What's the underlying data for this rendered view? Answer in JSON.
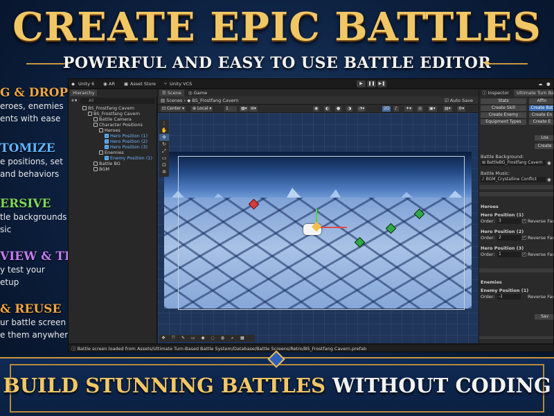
{
  "banner": {
    "title": "CREATE EPIC BATTLES",
    "subtitle": "POWERFUL AND EASY TO USE BATTLE EDITOR",
    "bottom_gold_1": "BUILD STUNNING ",
    "bottom_gold_2": "BATTLES",
    "bottom_white": " WITHOUT CODING"
  },
  "features": [
    {
      "heading": "G & DROP",
      "color": "#f1a640",
      "lines": [
        "eroes, enemies",
        "ents with ease"
      ]
    },
    {
      "heading": "TOMIZE",
      "color": "#5fb6ff",
      "lines": [
        "e positions, set",
        " and behaviors"
      ]
    },
    {
      "heading": "ERSIVE",
      "color": "#7ed957",
      "lines": [
        "tle backgrounds",
        "sic"
      ]
    },
    {
      "heading": "VIEW & TEST",
      "color": "#c47df0",
      "lines": [
        "y test your",
        "etup"
      ]
    },
    {
      "heading": "& REUSE",
      "color": "#f1a640",
      "lines": [
        "ur battle screen",
        "e them anywhere"
      ]
    }
  ],
  "toolbar": {
    "unity": "Unity 6",
    "ar": "AR",
    "asset_store": "Asset Store",
    "vcs": "Unity VCS",
    "play": "▶",
    "pause": "❚❚",
    "step": "▶❚"
  },
  "hierarchy": {
    "tab": "Hierarchy",
    "search_placeholder": "All",
    "items": [
      {
        "label": "BS_Frostfang Cavern",
        "indent": 1,
        "blue": false
      },
      {
        "label": "BS_Frostfang Cavern",
        "indent": 2,
        "blue": false
      },
      {
        "label": "Battle Camera",
        "indent": 3,
        "blue": false
      },
      {
        "label": "Character Positions",
        "indent": 3,
        "blue": false
      },
      {
        "label": "Heroes",
        "indent": 4,
        "blue": false
      },
      {
        "label": "Hero Position (1)",
        "indent": 5,
        "blue": true
      },
      {
        "label": "Hero Position (2)",
        "indent": 5,
        "blue": true
      },
      {
        "label": "Hero Position (3)",
        "indent": 5,
        "blue": true
      },
      {
        "label": "Enemies",
        "indent": 4,
        "blue": false
      },
      {
        "label": "Enemy Position (1)",
        "indent": 5,
        "blue": true
      },
      {
        "label": "Battle BG",
        "indent": 3,
        "blue": false
      },
      {
        "label": "BGM",
        "indent": 3,
        "blue": false
      }
    ]
  },
  "scene": {
    "tab_scene": "Scene",
    "tab_game": "Game",
    "breadcrumb_root": "Scenes",
    "breadcrumb_item": "BS_Frostfang Cavern",
    "auto_save": "Auto Save",
    "pivot": "Center",
    "space": "Local",
    "snap": "1",
    "mode_2d": "2D"
  },
  "inspector": {
    "tab_inspector": "Inspector",
    "tab_ultimate": "Ultimate Turn Bas",
    "buttons": {
      "stats": "Stats",
      "affin": "Affin",
      "create_skill": "Create Skill",
      "create_bat": "Create Bat",
      "create_enemy": "Create Enemy",
      "create_en": "Create En",
      "equipment_types": "Equipment Types",
      "create_e": "Create E",
      "loa": "Loa",
      "create": "Create",
      "sav": "Sav"
    },
    "battle_background_label": "Battle Background:",
    "battle_background_value": "BattleBG_Frostfang Cavern",
    "battle_music_label": "Battle Music:",
    "battle_music_value": "BGM_Crystalline Conflict",
    "heroes_header": "Heroes",
    "heroes": [
      {
        "name": "Hero Position (1)",
        "order_label": "Order:",
        "order": "3",
        "reverse": "Reverse Fac"
      },
      {
        "name": "Hero Position (2)",
        "order_label": "Order:",
        "order": "2",
        "reverse": "Reverse Fac"
      },
      {
        "name": "Hero Position (3)",
        "order_label": "Order:",
        "order": "1",
        "reverse": "Reverse Fac"
      }
    ],
    "enemies_header": "Enemies",
    "enemies": [
      {
        "name": "Enemy Position (1)",
        "order_label": "Order:",
        "order": "-1",
        "reverse": "Reverse Fac"
      }
    ]
  },
  "status": {
    "text": "Battle screen loaded from Assets/Ultimate Turn-Based Battle System/Database/Battle Screens/Retro/BS_Frostfang Cavern.prefab"
  },
  "colors": {
    "gold": "#f1c766",
    "selected_blue": "#3d6eb0",
    "red_gem": "#d83a3a",
    "green_gem": "#2fa84a"
  }
}
